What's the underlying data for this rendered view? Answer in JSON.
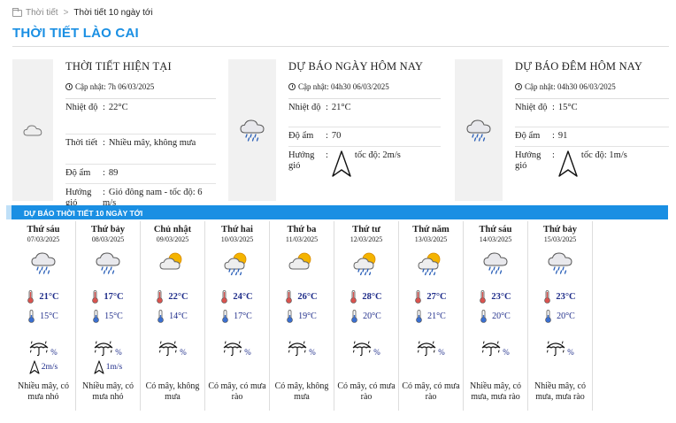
{
  "breadcrumb": {
    "home": "Thời tiết",
    "separator": ">",
    "current": "Thời tiết 10 ngày tới"
  },
  "page_title": "THỜI TIẾT LÀO CAI",
  "current": {
    "title": "THỜI TIẾT HIỆN TẠI",
    "updated": "Cập nhật: 7h 06/03/2025",
    "icon": "cloud-icon",
    "rows": [
      {
        "k": "Nhiệt độ",
        "v": "22°C"
      },
      {
        "k": "Thời tiết",
        "v": "Nhiều mây, không mưa"
      },
      {
        "k": "Độ ẩm",
        "v": "89"
      },
      {
        "k": "Hướng gió",
        "v": "Gió đông nam - tốc độ: 6 m/s"
      }
    ]
  },
  "day_forecast": {
    "title": "DỰ BÁO NGÀY HÔM NAY",
    "updated": "Cập nhật: 04h30 06/03/2025",
    "icon": "rain-cloud-icon",
    "temp_label": "Nhiệt độ",
    "temp": "21°C",
    "humidity_label": "Độ ẩm",
    "humidity": "70",
    "wind_label": "Hướng gió",
    "wind": "tốc độ: 2m/s"
  },
  "night_forecast": {
    "title": "DỰ BÁO ĐÊM HÔM NAY",
    "updated": "Cập nhật: 04h30 06/03/2025",
    "icon": "rain-cloud-icon",
    "temp_label": "Nhiệt độ",
    "temp": "15°C",
    "humidity_label": "Độ ẩm",
    "humidity": "91",
    "wind_label": "Hướng gió",
    "wind": "tốc độ: 1m/s"
  },
  "forecast_header": "DỰ BÁO THỜI TIẾT 10 NGÀY TỚI",
  "days": [
    {
      "name": "Thứ sáu",
      "date": "07/03/2025",
      "icon": "rain-cloud-icon",
      "hi": "21°C",
      "lo": "15°C",
      "rain": "%",
      "wind": "2m/s",
      "desc": "Nhiều mây, có mưa nhỏ"
    },
    {
      "name": "Thứ bảy",
      "date": "08/03/2025",
      "icon": "rain-cloud-icon",
      "hi": "17°C",
      "lo": "15°C",
      "rain": "%",
      "wind": "1m/s",
      "desc": "Nhiều mây, có mưa nhỏ"
    },
    {
      "name": "Chủ nhật",
      "date": "09/03/2025",
      "icon": "sun-cloud-icon",
      "hi": "22°C",
      "lo": "14°C",
      "rain": "%",
      "wind": "",
      "desc": "Có mây, không mưa"
    },
    {
      "name": "Thứ hai",
      "date": "10/03/2025",
      "icon": "sun-rain-cloud-icon",
      "hi": "24°C",
      "lo": "17°C",
      "rain": "%",
      "wind": "",
      "desc": "Có mây, có mưa rào"
    },
    {
      "name": "Thứ ba",
      "date": "11/03/2025",
      "icon": "sun-cloud-icon",
      "hi": "26°C",
      "lo": "19°C",
      "rain": "%",
      "wind": "",
      "desc": "Có mây, không mưa"
    },
    {
      "name": "Thứ tư",
      "date": "12/03/2025",
      "icon": "sun-rain-cloud-icon",
      "hi": "28°C",
      "lo": "20°C",
      "rain": "%",
      "wind": "",
      "desc": "Có mây, có mưa rào"
    },
    {
      "name": "Thứ năm",
      "date": "13/03/2025",
      "icon": "sun-rain-cloud-icon",
      "hi": "27°C",
      "lo": "21°C",
      "rain": "%",
      "wind": "",
      "desc": "Có mây, có mưa rào"
    },
    {
      "name": "Thứ sáu",
      "date": "14/03/2025",
      "icon": "rain-cloud-icon",
      "hi": "23°C",
      "lo": "20°C",
      "rain": "%",
      "wind": "",
      "desc": "Nhiều mây, có mưa, mưa rào"
    },
    {
      "name": "Thứ bảy",
      "date": "15/03/2025",
      "icon": "rain-cloud-icon",
      "hi": "23°C",
      "lo": "20°C",
      "rain": "%",
      "wind": "",
      "desc": "Nhiều mây, có mưa, mưa rào"
    }
  ],
  "colors": {
    "accent": "#1a8fe3",
    "temp_text": "#1f2d8a",
    "hot_thermometer": "#d9534f",
    "cold_thermometer": "#3a6fd0"
  }
}
